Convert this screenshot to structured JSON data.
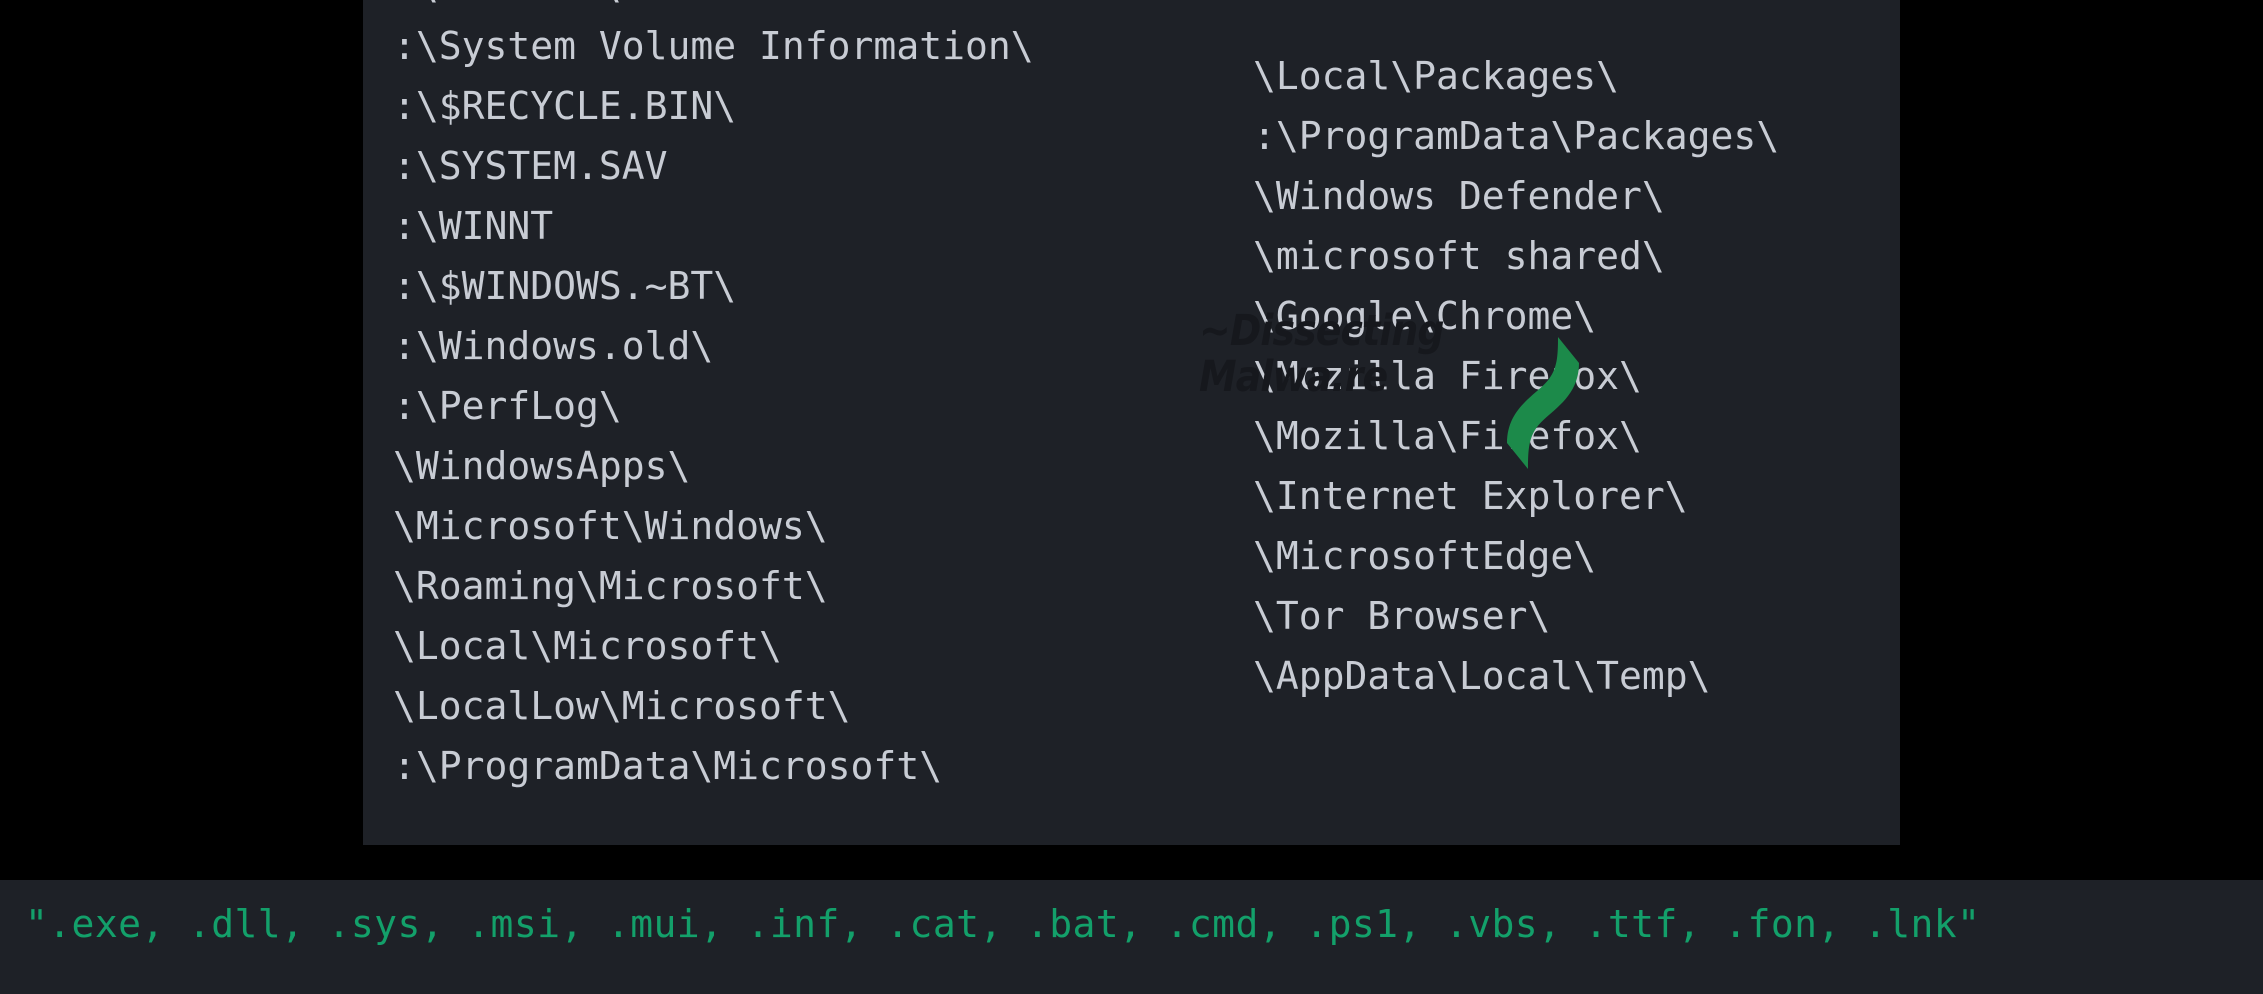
{
  "colors": {
    "page_background": "#000000",
    "panel_background": "#1e2127",
    "path_text": "#c8ccd4",
    "extension_text": "#13a06a",
    "watermark_text": "#16181d",
    "logo_green": "#1c8a4a"
  },
  "paths_panel": {
    "left_column": [
      ":\\Windows\\",
      ":\\System Volume Information\\",
      ":\\$RECYCLE.BIN\\",
      ":\\SYSTEM.SAV",
      ":\\WINNT",
      ":\\$WINDOWS.~BT\\",
      ":\\Windows.old\\",
      ":\\PerfLog\\",
      "\\WindowsApps\\",
      "\\Microsoft\\Windows\\",
      "\\Roaming\\Microsoft\\",
      "\\Local\\Microsoft\\",
      "\\LocalLow\\Microsoft\\",
      ":\\ProgramData\\Microsoft\\"
    ],
    "right_column": [
      "\\Local\\Packages\\",
      ":\\ProgramData\\Packages\\",
      "\\Windows Defender\\",
      "\\microsoft shared\\",
      "\\Google\\Chrome\\",
      "\\Mozilla Firefox\\",
      "\\Mozilla\\Firefox\\",
      "\\Internet Explorer\\",
      "\\MicrosoftEdge\\",
      "\\Tor Browser\\",
      "\\AppData\\Local\\Temp\\"
    ]
  },
  "watermark": {
    "line1": "~Dissecting",
    "line2": "Malwa.re",
    "logo_name": "dissecting-malware-swoosh-logo"
  },
  "extensions_bar": {
    "text": "\".exe, .dll, .sys, .msi, .mui, .inf, .cat, .bat, .cmd, .ps1, .vbs, .ttf, .fon, .lnk\""
  }
}
